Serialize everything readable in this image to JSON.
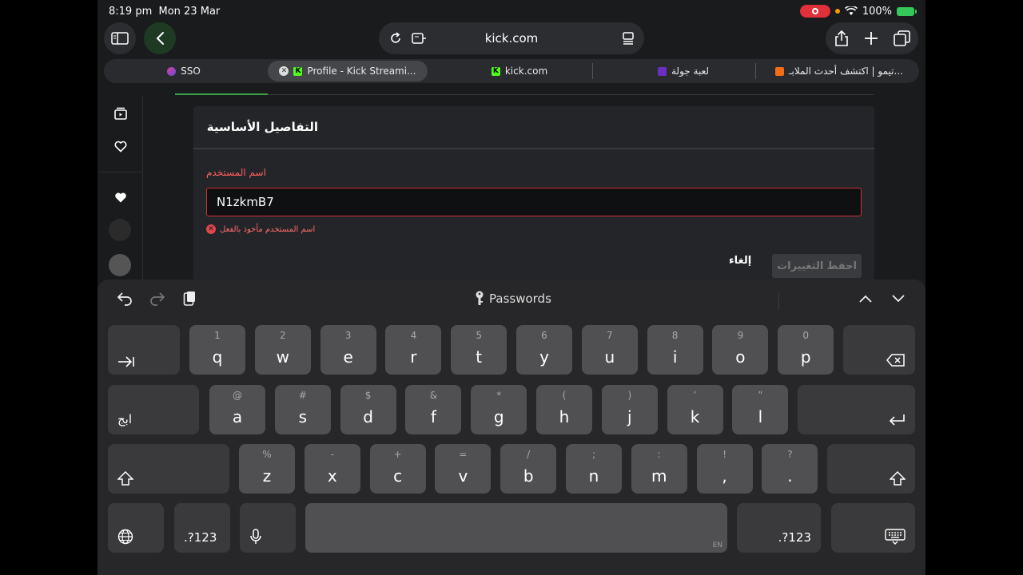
{
  "status": {
    "time": "8:19 pm",
    "date": "Mon 23 Mar",
    "battery": "100%"
  },
  "browser": {
    "url": "kick.com",
    "tabs": [
      {
        "label": "SSO",
        "active": false
      },
      {
        "label": "Profile - Kick Streami...",
        "active": true
      },
      {
        "label": "kick.com",
        "active": false
      },
      {
        "label": "لعبة جولة",
        "active": false
      },
      {
        "label": "تيمو | اكتشف أحدث الملابـ...",
        "active": false
      }
    ]
  },
  "page": {
    "section_title": "التفاصيل الأساسية",
    "username_label": "اسم المستخدم",
    "username_value": "N1zkmB7",
    "error_text": "اسم المستخدم مأخوذ بالفعل",
    "cancel_label": "إلغاء",
    "save_label": "احفظ التغييرات"
  },
  "keyboard": {
    "passwords_label": "Passwords",
    "row1": [
      {
        "sub": "1",
        "main": "q"
      },
      {
        "sub": "2",
        "main": "w"
      },
      {
        "sub": "3",
        "main": "e"
      },
      {
        "sub": "4",
        "main": "r"
      },
      {
        "sub": "5",
        "main": "t"
      },
      {
        "sub": "6",
        "main": "y"
      },
      {
        "sub": "7",
        "main": "u"
      },
      {
        "sub": "8",
        "main": "i"
      },
      {
        "sub": "9",
        "main": "o"
      },
      {
        "sub": "0",
        "main": "p"
      }
    ],
    "row2": [
      {
        "sub": "@",
        "main": "a"
      },
      {
        "sub": "#",
        "main": "s"
      },
      {
        "sub": "$",
        "main": "d"
      },
      {
        "sub": "&",
        "main": "f"
      },
      {
        "sub": "*",
        "main": "g"
      },
      {
        "sub": "(",
        "main": "h"
      },
      {
        "sub": ")",
        "main": "j"
      },
      {
        "sub": "’",
        "main": "k"
      },
      {
        "sub": "”",
        "main": "l"
      }
    ],
    "row3": [
      {
        "sub": "%",
        "main": "z"
      },
      {
        "sub": "-",
        "main": "x"
      },
      {
        "sub": "+",
        "main": "c"
      },
      {
        "sub": "=",
        "main": "v"
      },
      {
        "sub": "/",
        "main": "b"
      },
      {
        "sub": ";",
        "main": "n"
      },
      {
        "sub": ":",
        "main": "m"
      },
      {
        "sub": "!",
        "main": ","
      },
      {
        "sub": "?",
        "main": "."
      }
    ],
    "lang_key": "ابج",
    "numbers_key": ".?123",
    "space_lang": "EN"
  }
}
